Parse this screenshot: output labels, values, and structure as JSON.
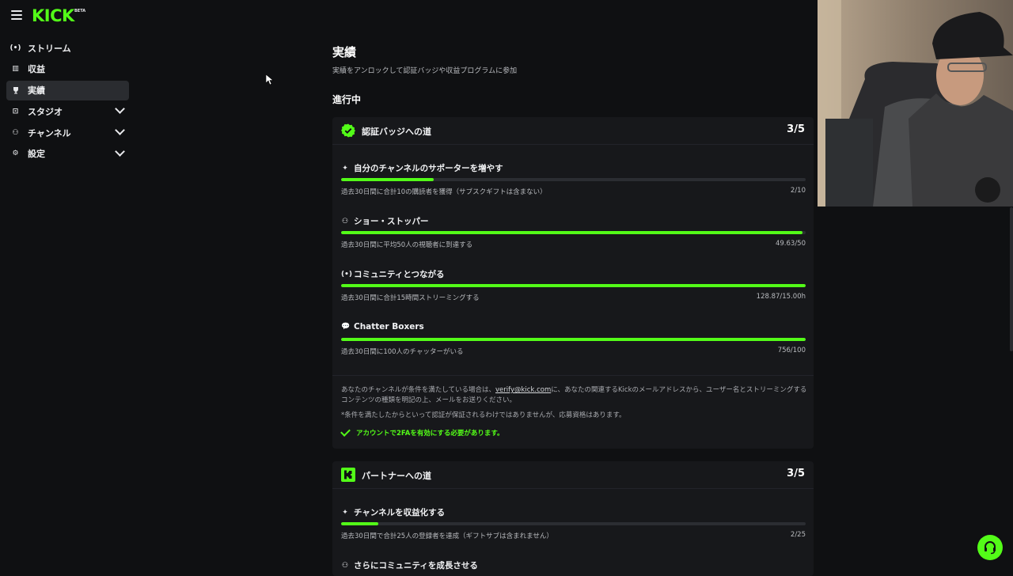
{
  "app": {
    "logo_text": "KICK",
    "logo_badge": "BETA",
    "accent": "#53fc18"
  },
  "sidebar": {
    "items": [
      {
        "label": "ストリーム",
        "icon": "broadcast-icon",
        "glyph": "(•)",
        "active": false,
        "expandable": false
      },
      {
        "label": "収益",
        "icon": "revenue-icon",
        "glyph": "▥",
        "active": false,
        "expandable": false
      },
      {
        "label": "実績",
        "icon": "trophy-icon",
        "glyph": "🏆",
        "active": true,
        "expandable": false
      },
      {
        "label": "スタジオ",
        "icon": "studio-icon",
        "glyph": "⊡",
        "active": false,
        "expandable": true
      },
      {
        "label": "チャンネル",
        "icon": "channel-icon",
        "glyph": "⚇",
        "active": false,
        "expandable": true
      },
      {
        "label": "設定",
        "icon": "gear-icon",
        "glyph": "⚙",
        "active": false,
        "expandable": true
      }
    ]
  },
  "page": {
    "title": "実績",
    "subtitle": "実績をアンロックして認証バッジや収益プログラムに参加",
    "section": "進行中"
  },
  "verified": {
    "title": "認証バッジへの道",
    "count": "3/5",
    "tasks": [
      {
        "icon": "sparkle-icon",
        "glyph": "✦",
        "title": "自分のチャンネルのサポーターを増やす",
        "desc": "過去30日間に合計10の購読者を獲得（サブスクギフトは含まない）",
        "value": "2/10",
        "progress": 0.2
      },
      {
        "icon": "viewers-icon",
        "glyph": "⚇",
        "title": "ショー・ストッパー",
        "desc": "過去30日間に平均50人の視聴者に到達する",
        "value": "49.63/50",
        "progress": 0.9926
      },
      {
        "icon": "broadcast-icon",
        "glyph": "(•)",
        "title": "コミュニティとつながる",
        "desc": "過去30日間に合計15時間ストリーミングする",
        "value": "128.87/15.00h",
        "progress": 1.0
      },
      {
        "icon": "chat-icon",
        "glyph": "💬",
        "title": "Chatter Boxers",
        "desc": "過去30日間に100人のチャッターがいる",
        "value": "756/100",
        "progress": 1.0
      }
    ],
    "note_prefix": "あなたのチャンネルが条件を満たしている場合は、",
    "note_email": "verify@kick.com",
    "note_suffix": "に、あなたの関連するKickのメールアドレスから、ユーザー名とストリーミングするコンテンツの種類を明記の上、メールをお送りください。",
    "disclaimer": "*条件を満たしたからといって認証が保証されるわけではありませんが、応募資格はあります。",
    "requirement": "アカウントで2FAを有効にする必要があります。"
  },
  "partner": {
    "title": "パートナーへの道",
    "count": "3/5",
    "tasks": [
      {
        "icon": "sparkle-icon",
        "glyph": "✦",
        "title": "チャンネルを収益化する",
        "desc": "過去30日間で合計25人の登録者を達成（ギフトサブは含まれません）",
        "value": "2/25",
        "progress": 0.08
      },
      {
        "icon": "viewers-icon",
        "glyph": "⚇",
        "title": "さらにコミュニティを成長させる"
      }
    ]
  },
  "help_button": {
    "icon": "headset-icon"
  }
}
